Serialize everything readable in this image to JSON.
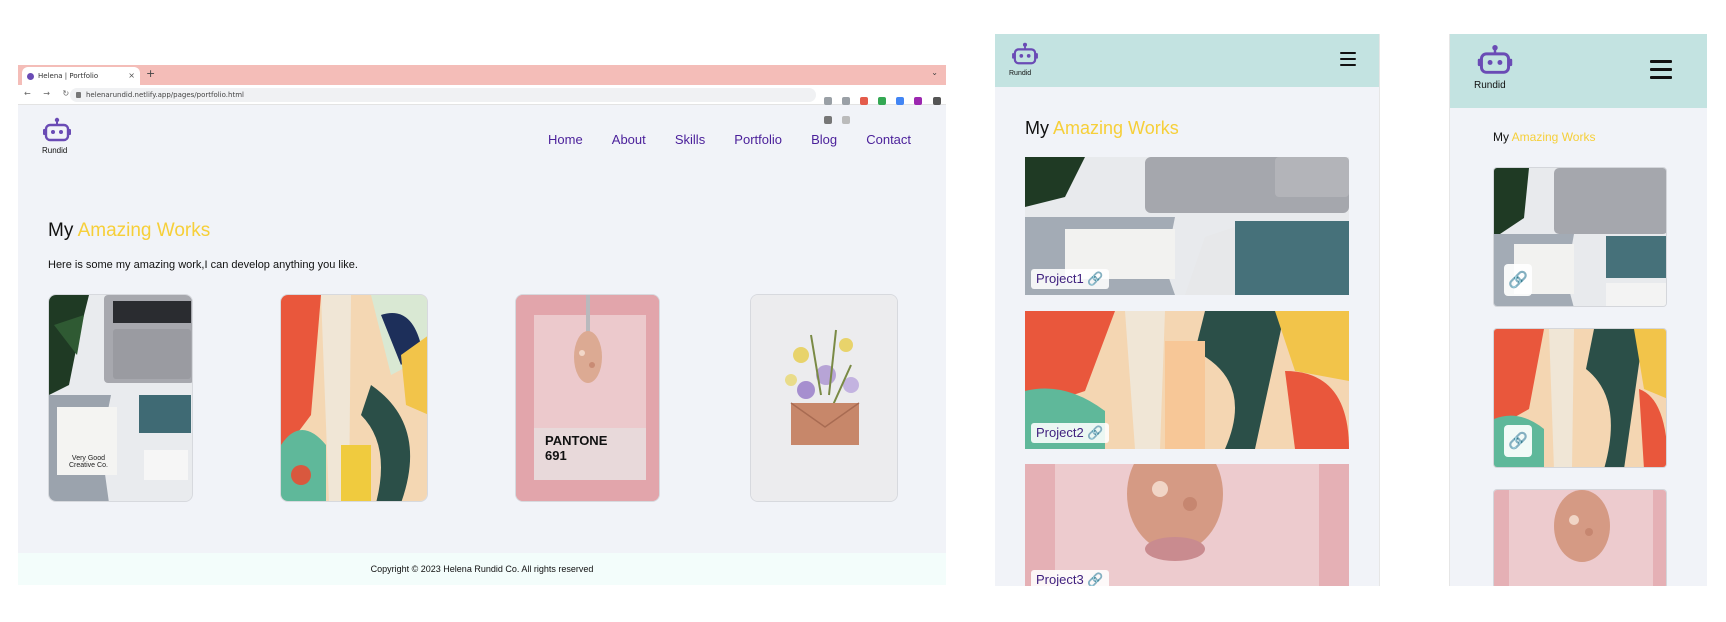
{
  "browser": {
    "tab_title": "Helena | Portfolio",
    "tab_close": "×",
    "new_tab": "+",
    "tab_menu": "⌄",
    "nav_icons": "← → ↻",
    "url": "helenarundid.netlify.app/pages/portfolio.html"
  },
  "brand": {
    "name": "Rundid"
  },
  "nav": {
    "items": [
      "Home",
      "About",
      "Skills",
      "Portfolio",
      "Blog",
      "Contact"
    ]
  },
  "portfolio": {
    "heading_my": "My",
    "heading_accent": "Amazing Works",
    "subtitle": "Here is some my amazing work,I can develop anything you like."
  },
  "cards": {
    "card1_text1": "Very Good",
    "card1_text2": "Creative Co.",
    "card3_text1": "PANTONE",
    "card3_text2": "691"
  },
  "tablet": {
    "projects": [
      "Project1",
      "Project2",
      "Project3"
    ]
  },
  "footer": {
    "copyright": "Copyright © 2023 Helena Rundid Co. All rights reserved"
  },
  "colors": {
    "accent": "#f6cf39",
    "nav": "#4a1f9a",
    "header_bg": "#c3e3e1",
    "tab_bar": "#f4bdb8",
    "page_bg": "#f1f3f8"
  }
}
